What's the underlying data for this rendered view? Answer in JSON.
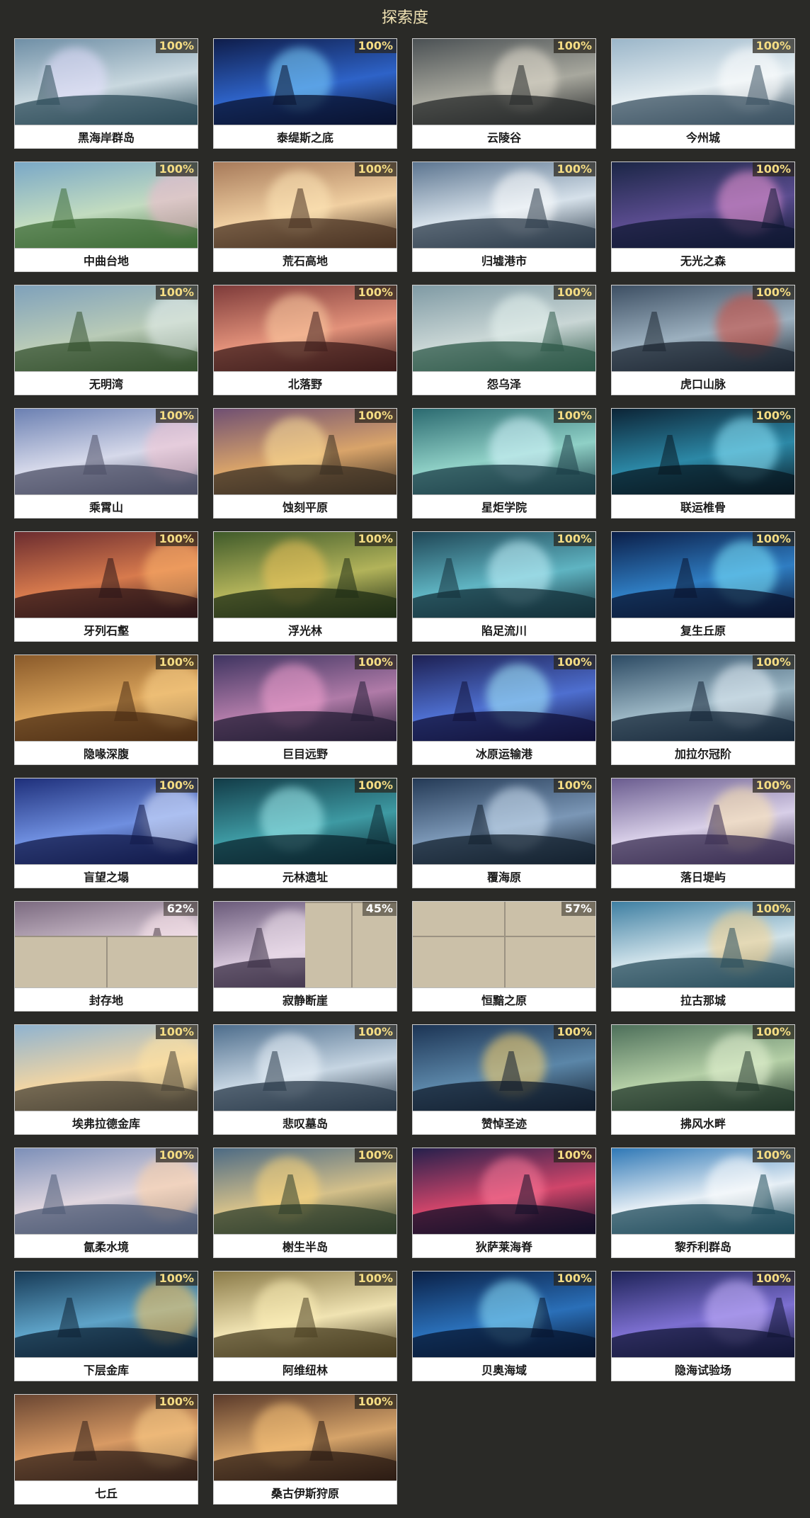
{
  "page": {
    "title": "探索度"
  },
  "regions": [
    {
      "name": "黑海岸群岛",
      "progress": "100%",
      "colors": [
        "#6f8fa6",
        "#c9d8df",
        "#2e4c59"
      ],
      "accent": "#e7e1ff",
      "fog": ""
    },
    {
      "name": "泰缇斯之底",
      "progress": "100%",
      "colors": [
        "#0f1d4a",
        "#2e63c8",
        "#0a1330"
      ],
      "accent": "#7fd6ff",
      "fog": ""
    },
    {
      "name": "云陵谷",
      "progress": "100%",
      "colors": [
        "#4b5154",
        "#a8a89e",
        "#27292a"
      ],
      "accent": "#e6e0d2",
      "fog": ""
    },
    {
      "name": "今州城",
      "progress": "100%",
      "colors": [
        "#9bb6c9",
        "#e4edf1",
        "#3b5161"
      ],
      "accent": "#ffffff",
      "fog": ""
    },
    {
      "name": "中曲台地",
      "progress": "100%",
      "colors": [
        "#7aa8c7",
        "#c2dcc0",
        "#3d6b36"
      ],
      "accent": "#f2b8cf",
      "fog": ""
    },
    {
      "name": "荒石高地",
      "progress": "100%",
      "colors": [
        "#a77a5a",
        "#f0cfa1",
        "#4a3323"
      ],
      "accent": "#ffe7b8",
      "fog": ""
    },
    {
      "name": "归墟港市",
      "progress": "100%",
      "colors": [
        "#5c7590",
        "#d6e1ea",
        "#2d3c4b"
      ],
      "accent": "#ffffff",
      "fog": ""
    },
    {
      "name": "无光之森",
      "progress": "100%",
      "colors": [
        "#1b2646",
        "#5a4c8f",
        "#101833"
      ],
      "accent": "#f49ad8",
      "fog": ""
    },
    {
      "name": "无明湾",
      "progress": "100%",
      "colors": [
        "#7fa1bb",
        "#b9cbb7",
        "#35522f"
      ],
      "accent": "#e8f1f0",
      "fog": ""
    },
    {
      "name": "北落野",
      "progress": "100%",
      "colors": [
        "#7e3b3a",
        "#e2917a",
        "#3e1c1b"
      ],
      "accent": "#ffd0a4",
      "fog": ""
    },
    {
      "name": "怨乌泽",
      "progress": "100%",
      "colors": [
        "#7f9aa4",
        "#c9d6d5",
        "#2f5a4a"
      ],
      "accent": "#e8f5f1",
      "fog": ""
    },
    {
      "name": "虎口山脉",
      "progress": "100%",
      "colors": [
        "#3d4f63",
        "#9cb0bf",
        "#1c2631"
      ],
      "accent": "#d24a3b",
      "fog": ""
    },
    {
      "name": "乘霄山",
      "progress": "100%",
      "colors": [
        "#6b80b2",
        "#d6d9ea",
        "#4c4f66"
      ],
      "accent": "#f3c4d2",
      "fog": ""
    },
    {
      "name": "蚀刻平原",
      "progress": "100%",
      "colors": [
        "#6f4f72",
        "#d9a46a",
        "#3a2f23"
      ],
      "accent": "#ffe29a",
      "fog": ""
    },
    {
      "name": "星炬学院",
      "progress": "100%",
      "colors": [
        "#2b6a70",
        "#8fd0c6",
        "#1b3e47"
      ],
      "accent": "#d8f7ff",
      "fog": ""
    },
    {
      "name": "联运椎骨",
      "progress": "100%",
      "colors": [
        "#0c2436",
        "#2c88a6",
        "#081822"
      ],
      "accent": "#8fe9ff",
      "fog": ""
    },
    {
      "name": "牙列石壑",
      "progress": "100%",
      "colors": [
        "#6b2c2f",
        "#d77a4d",
        "#2c1518"
      ],
      "accent": "#ffb56b",
      "fog": ""
    },
    {
      "name": "浮光林",
      "progress": "100%",
      "colors": [
        "#3f5a2a",
        "#b2b35a",
        "#1f2d16"
      ],
      "accent": "#f0c45a",
      "fog": ""
    },
    {
      "name": "陷足流川",
      "progress": "100%",
      "colors": [
        "#1f4656",
        "#5fb4c2",
        "#14303a"
      ],
      "accent": "#c8f6ff",
      "fog": ""
    },
    {
      "name": "复生丘原",
      "progress": "100%",
      "colors": [
        "#0b1e48",
        "#2f7dc2",
        "#0a1430"
      ],
      "accent": "#7de8ff",
      "fog": ""
    },
    {
      "name": "隐喙深腹",
      "progress": "100%",
      "colors": [
        "#8a5a2a",
        "#d8a25a",
        "#4c2e14"
      ],
      "accent": "#ffd58c",
      "fog": ""
    },
    {
      "name": "巨目远野",
      "progress": "100%",
      "colors": [
        "#3e3460",
        "#b07ba8",
        "#241d36"
      ],
      "accent": "#f6a2d1",
      "fog": ""
    },
    {
      "name": "冰原运输港",
      "progress": "100%",
      "colors": [
        "#1d2052",
        "#4e6fd0",
        "#11123a"
      ],
      "accent": "#a9f2ff",
      "fog": ""
    },
    {
      "name": "加拉尔冠阶",
      "progress": "100%",
      "colors": [
        "#2c4a63",
        "#9bb6c4",
        "#17283a"
      ],
      "accent": "#e9f3fa",
      "fog": ""
    },
    {
      "name": "盲望之塌",
      "progress": "100%",
      "colors": [
        "#1e2f7a",
        "#6f8fe0",
        "#121a4a"
      ],
      "accent": "#dfe8ff",
      "fog": ""
    },
    {
      "name": "元林遗址",
      "progress": "100%",
      "colors": [
        "#123b47",
        "#3e9aa3",
        "#0b262f"
      ],
      "accent": "#a5f0f2",
      "fog": ""
    },
    {
      "name": "覆海原",
      "progress": "100%",
      "colors": [
        "#243a56",
        "#7b97b6",
        "#14212f"
      ],
      "accent": "#d2e4f5",
      "fog": ""
    },
    {
      "name": "落日堤屿",
      "progress": "100%",
      "colors": [
        "#6a5c8f",
        "#d8cfe8",
        "#3a2e52"
      ],
      "accent": "#ffe6b0",
      "fog": ""
    },
    {
      "name": "封存地",
      "progress": "62%",
      "colors": [
        "#7b6a80",
        "#d8c9d5",
        "#4a3c46"
      ],
      "accent": "#ffe9ef",
      "fog": "bottom"
    },
    {
      "name": "寂静断崖",
      "progress": "45%",
      "colors": [
        "#6a5a7a",
        "#d4c4d8",
        "#3b2f46"
      ],
      "accent": "#f6e8f2",
      "fog": "right"
    },
    {
      "name": "恒黯之原",
      "progress": "57%",
      "colors": [
        "#6b675f",
        "#b8b3a6",
        "#3e3b35"
      ],
      "accent": "#e8e4d8",
      "fog": "full"
    },
    {
      "name": "拉古那城",
      "progress": "100%",
      "colors": [
        "#3e7fa2",
        "#cfe2ea",
        "#2a4e5c"
      ],
      "accent": "#f7d38d",
      "fog": ""
    },
    {
      "name": "埃弗拉德金库",
      "progress": "100%",
      "colors": [
        "#8fb3d0",
        "#f0d5a4",
        "#4a4336"
      ],
      "accent": "#ffe3a3",
      "fog": ""
    },
    {
      "name": "悲叹墓岛",
      "progress": "100%",
      "colors": [
        "#4d6d8c",
        "#c6d5e2",
        "#2a3a4a"
      ],
      "accent": "#eef5fb",
      "fog": ""
    },
    {
      "name": "赞悼圣迹",
      "progress": "100%",
      "colors": [
        "#1c3454",
        "#5b86a8",
        "#121e2e"
      ],
      "accent": "#ffd46b",
      "fog": ""
    },
    {
      "name": "拂风水畔",
      "progress": "100%",
      "colors": [
        "#4d6f5a",
        "#b4cfa6",
        "#23382b"
      ],
      "accent": "#e9f6d6",
      "fog": ""
    },
    {
      "name": "氤柔水境",
      "progress": "100%",
      "colors": [
        "#7c8fb8",
        "#e0d6df",
        "#4d5a74"
      ],
      "accent": "#ffd2a6",
      "fog": ""
    },
    {
      "name": "榭生半岛",
      "progress": "100%",
      "colors": [
        "#4c6a84",
        "#d4c08a",
        "#2e3e2b"
      ],
      "accent": "#ffd77a",
      "fog": ""
    },
    {
      "name": "狄萨莱海脊",
      "progress": "100%",
      "colors": [
        "#25204c",
        "#d0456a",
        "#120f28"
      ],
      "accent": "#ff7a9a",
      "fog": ""
    },
    {
      "name": "黎乔利群岛",
      "progress": "100%",
      "colors": [
        "#2f78b6",
        "#e5eef5",
        "#1d4a5a"
      ],
      "accent": "#ffffff",
      "fog": ""
    },
    {
      "name": "下层金库",
      "progress": "100%",
      "colors": [
        "#173a56",
        "#5ea3c8",
        "#0e2234"
      ],
      "accent": "#ffc65c",
      "fog": ""
    },
    {
      "name": "阿维纽林",
      "progress": "100%",
      "colors": [
        "#8a7a48",
        "#f0e3b2",
        "#4a3f22"
      ],
      "accent": "#fff1b8",
      "fog": ""
    },
    {
      "name": "贝奥海域",
      "progress": "100%",
      "colors": [
        "#0a2046",
        "#2a6fb8",
        "#071630"
      ],
      "accent": "#8fe5ff",
      "fog": ""
    },
    {
      "name": "隐海试验场",
      "progress": "100%",
      "colors": [
        "#1e2358",
        "#7c6fd0",
        "#121536"
      ],
      "accent": "#c9b5ff",
      "fog": ""
    },
    {
      "name": "七丘",
      "progress": "100%",
      "colors": [
        "#6a4632",
        "#d89a64",
        "#33211a"
      ],
      "accent": "#ffd28a",
      "fog": ""
    },
    {
      "name": "桑古伊斯狩原",
      "progress": "100%",
      "colors": [
        "#5a3a2a",
        "#d6a46a",
        "#2c1c14"
      ],
      "accent": "#ffc87a",
      "fog": ""
    }
  ]
}
